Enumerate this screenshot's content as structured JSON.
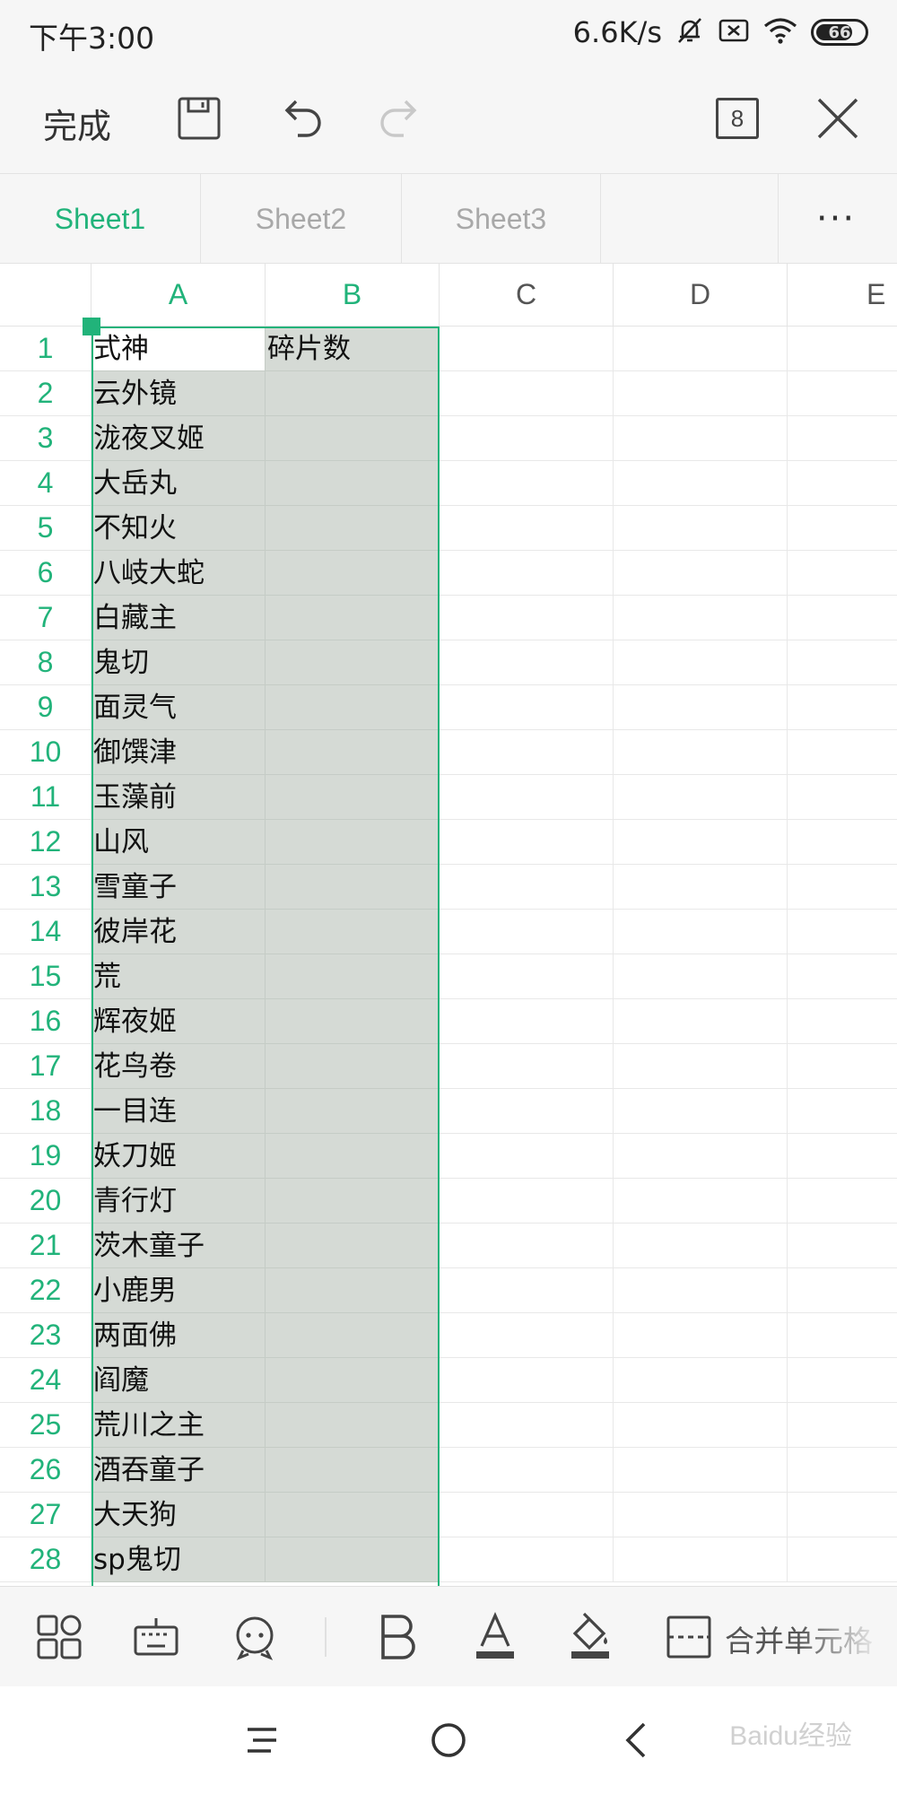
{
  "status_bar": {
    "time": "下午3:00",
    "speed": "6.6K/s",
    "battery": "66"
  },
  "toolbar": {
    "done_label": "完成",
    "window_count": "8"
  },
  "sheet_tabs": [
    "Sheet1",
    "Sheet2",
    "Sheet3"
  ],
  "more_label": "···",
  "columns": [
    "A",
    "B",
    "C",
    "D",
    "E"
  ],
  "rows": [
    {
      "num": "1",
      "a": "式神",
      "b": "碎片数"
    },
    {
      "num": "2",
      "a": "云外镜",
      "b": ""
    },
    {
      "num": "3",
      "a": "泷夜叉姬",
      "b": ""
    },
    {
      "num": "4",
      "a": "大岳丸",
      "b": ""
    },
    {
      "num": "5",
      "a": "不知火",
      "b": ""
    },
    {
      "num": "6",
      "a": "八岐大蛇",
      "b": ""
    },
    {
      "num": "7",
      "a": "白藏主",
      "b": ""
    },
    {
      "num": "8",
      "a": "鬼切",
      "b": ""
    },
    {
      "num": "9",
      "a": "面灵气",
      "b": ""
    },
    {
      "num": "10",
      "a": "御馔津",
      "b": ""
    },
    {
      "num": "11",
      "a": "玉藻前",
      "b": ""
    },
    {
      "num": "12",
      "a": "山风",
      "b": ""
    },
    {
      "num": "13",
      "a": "雪童子",
      "b": ""
    },
    {
      "num": "14",
      "a": "彼岸花",
      "b": ""
    },
    {
      "num": "15",
      "a": "荒",
      "b": ""
    },
    {
      "num": "16",
      "a": "辉夜姬",
      "b": ""
    },
    {
      "num": "17",
      "a": "花鸟卷",
      "b": ""
    },
    {
      "num": "18",
      "a": "一目连",
      "b": ""
    },
    {
      "num": "19",
      "a": "妖刀姬",
      "b": ""
    },
    {
      "num": "20",
      "a": "青行灯",
      "b": ""
    },
    {
      "num": "21",
      "a": "茨木童子",
      "b": ""
    },
    {
      "num": "22",
      "a": "小鹿男",
      "b": ""
    },
    {
      "num": "23",
      "a": "两面佛",
      "b": ""
    },
    {
      "num": "24",
      "a": "阎魔",
      "b": ""
    },
    {
      "num": "25",
      "a": "荒川之主",
      "b": ""
    },
    {
      "num": "26",
      "a": "酒吞童子",
      "b": ""
    },
    {
      "num": "27",
      "a": "大天狗",
      "b": ""
    },
    {
      "num": "28",
      "a": "sp鬼切",
      "b": ""
    }
  ],
  "edit_bar": {
    "merge_label": "合并单元格"
  },
  "watermark": "Baidu经验",
  "colors": {
    "accent": "#21b37a",
    "selection_bg": "#d5dad5",
    "chrome_bg": "#f6f6f6"
  }
}
